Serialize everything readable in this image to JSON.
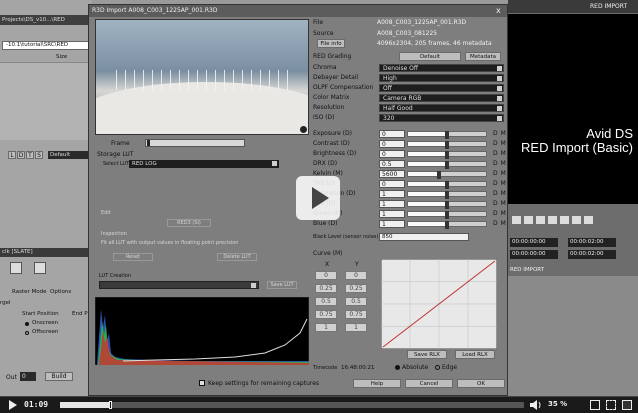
{
  "background_app": {
    "project_tab": "Projects\\DS_v10...\\RED",
    "path_field": "-10.1\\tutorial\\SRC\\RED",
    "column_header": "Size",
    "toolbar_letters": [
      "L",
      "D",
      "T",
      "S"
    ],
    "default_label": "Default",
    "panel_header": "clk [SLATE]",
    "tabs": [
      "Raster Mode",
      "Options"
    ],
    "start_position_label": "Start Position",
    "end_label": "End P",
    "options": [
      "Onscreen",
      "Offscreen"
    ],
    "out_label": "Out",
    "out_value": "0",
    "build_label": "Build",
    "left_edge_label": "rgel"
  },
  "dialog": {
    "title": "R3D Import A008_C003_1225AP_001.R3D",
    "close_symbol": "x",
    "frame_label": "Frame",
    "storage_lut_label": "Storage LUT",
    "select_lut_label": "Select LUT",
    "select_lut_value": "RED LOG",
    "edit_label": "Edit",
    "reds_label": "RED3 (Si)",
    "inspection_label": "Inspection",
    "fit_text": "Fit all LUT with output values in floating point precision",
    "reset_label": "Reset",
    "delete_lut_label": "Delete LUT",
    "lut_creation_label": "LUT Creation",
    "save_lut_label": "Save LUT",
    "info": {
      "file_label": "File",
      "file_value": "A008_C003_1225AP_001.R3D",
      "source_label": "Source",
      "source_value": "A008_C003_081225",
      "file_info_button": "File info",
      "resolution_info": "4096x2304, 205 frames, 46 metadata"
    },
    "red_grading_label": "RED Grading",
    "default_button": "Default",
    "metadata_button": "Metadata",
    "dropdowns": [
      {
        "label": "Chroma",
        "value": "Denoise Off"
      },
      {
        "label": "Debayer Detail",
        "value": "High"
      },
      {
        "label": "OLPF Compensation",
        "value": "Off"
      },
      {
        "label": "Color Matrix",
        "value": "Camera RGB"
      },
      {
        "label": "Resolution",
        "value": "Half Good"
      },
      {
        "label": "ISO (D)",
        "value": "320"
      }
    ],
    "sliders": [
      {
        "label": "Exposure (D)",
        "value": "0",
        "level": 0.5
      },
      {
        "label": "Contrast (D)",
        "value": "0",
        "level": 0.5
      },
      {
        "label": "Brightness (D)",
        "value": "0",
        "level": 0.5
      },
      {
        "label": "DRX (D)",
        "value": "0.5",
        "level": 0.5
      },
      {
        "label": "Kelvin (M)",
        "value": "5600",
        "level": 0.4
      },
      {
        "label": "Tint (D)",
        "value": "0",
        "level": 0.5
      },
      {
        "label": "Saturation (D)",
        "value": "1",
        "level": 0.5
      },
      {
        "label": "Red (D)",
        "value": "1",
        "level": 0.5
      },
      {
        "label": "Green (D)",
        "value": "1",
        "level": 0.5
      },
      {
        "label": "Blue (D)",
        "value": "1",
        "level": 0.5
      }
    ],
    "black_level_label": "Black Level (sensor noise)",
    "black_level_value": "850",
    "curve_label": "Curve (M)",
    "curve_x": "X",
    "curve_y": "Y",
    "curve_points": [
      [
        "0",
        "0"
      ],
      [
        "0.25",
        "0.25"
      ],
      [
        "0.5",
        "0.5"
      ],
      [
        "0.75",
        "0.75"
      ],
      [
        "1",
        "1"
      ]
    ],
    "save_rlx": "Save RLX",
    "load_rlx": "Load RLX",
    "timecode_label": "Timecode",
    "timecode_value": "16:48:00:21",
    "absolute_label": "Absolute",
    "edge_label": "Edge",
    "keep_settings_label": "Keep settings for remaining captures",
    "help_button": "Help",
    "cancel_button": "Cancel",
    "ok_button": "OK"
  },
  "right_panel": {
    "title": "RED IMPORT",
    "title_bottom": "RED IMPORT",
    "avid_line1": "Avid DS",
    "avid_line2": "RED Import (Basic)",
    "timecode1": "00:00:00:00",
    "timecode2": "00:00:02:00",
    "timecode3": "00:00:00:00",
    "timecode4": "00:00:02:00"
  },
  "player": {
    "current_time": "01:09",
    "volume": "35 %",
    "progress": 0.11
  }
}
